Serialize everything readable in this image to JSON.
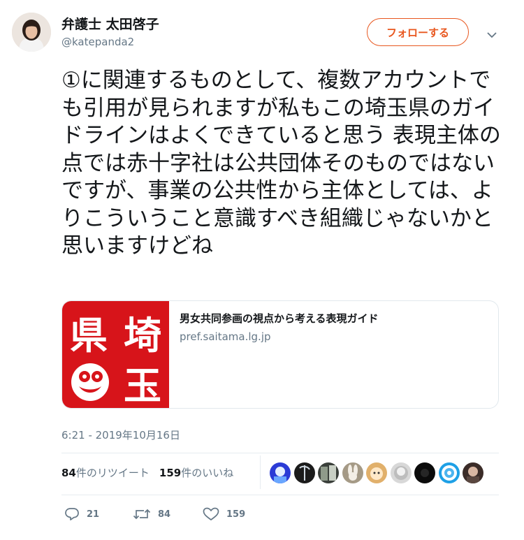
{
  "user": {
    "display_name": "弁護士 太田啓子",
    "handle": "@katepanda2"
  },
  "follow_button": {
    "label": "フォローする"
  },
  "tweet": {
    "text": "①に関連するものとして、複数アカウントでも引用が見られますが私もこの埼玉県のガイドラインはよくできていると思う 表現主体の点では赤十字社は公共団体そのものではないですが、事業の公共性から主体としては、よりこういうこと意識すべき組織じゃないかと思いますけどね"
  },
  "card": {
    "title": "男女共同参画の視点から考える表現ガイド",
    "domain": "pref.saitama.lg.jp",
    "image_text": "県埼玉"
  },
  "timestamp": "6:21 - 2019年10月16日",
  "stats": {
    "retweets_count": "84",
    "retweets_label": "件のリツイート",
    "likes_count": "159",
    "likes_label": "件のいいね"
  },
  "actions": {
    "reply_count": "21",
    "retweet_count": "84",
    "like_count": "159"
  },
  "colors": {
    "accent": "#e8571f",
    "text_primary": "#14171a",
    "text_secondary": "#657786",
    "saitama_red": "#d7141a"
  },
  "icons": [
    "chevron-down-icon",
    "reply-icon",
    "retweet-icon",
    "heart-icon"
  ]
}
